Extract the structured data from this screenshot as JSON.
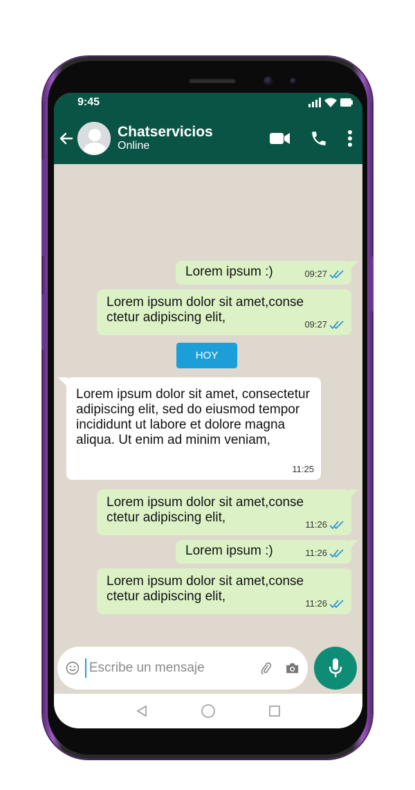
{
  "status": {
    "time": "9:45"
  },
  "header": {
    "title": "Chatservicios",
    "subtitle": "Online"
  },
  "messages": [
    {
      "dir": "out",
      "text": "Lorem ipsum :)",
      "time": "09:27"
    },
    {
      "dir": "out",
      "text": "Lorem ipsum dolor sit amet,conse ctetur adipiscing elit,",
      "time": "09:27"
    },
    {
      "dir": "in",
      "text": "Lorem ipsum dolor sit amet, consectetur adipiscing elit, sed do eiusmod tempor incididunt ut labore et dolore magna aliqua. Ut enim ad minim veniam,",
      "time": "11:25"
    },
    {
      "dir": "out",
      "text": "Lorem ipsum dolor sit amet,conse ctetur adipiscing elit,",
      "time": "11:26"
    },
    {
      "dir": "out",
      "text": "Lorem ipsum :)",
      "time": "11:26"
    },
    {
      "dir": "out",
      "text": "Lorem ipsum dolor sit amet,conse ctetur adipiscing elit,",
      "time": "11:26"
    }
  ],
  "day_label": "HOY",
  "composer": {
    "placeholder": "Escribe un mensaje"
  },
  "colors": {
    "header": "#0a5446",
    "outgoing": "#dcf2c6",
    "incoming": "#ffffff",
    "accent": "#1c9fd9",
    "mic": "#0f8c75",
    "background": "#ded8ce"
  },
  "icons": [
    "back-arrow-icon",
    "video-call-icon",
    "phone-icon",
    "more-vert-icon",
    "emoji-icon",
    "attach-icon",
    "camera-icon",
    "mic-icon",
    "nav-back-icon",
    "nav-home-icon",
    "nav-recents-icon",
    "signal-icon",
    "wifi-icon",
    "battery-icon"
  ]
}
